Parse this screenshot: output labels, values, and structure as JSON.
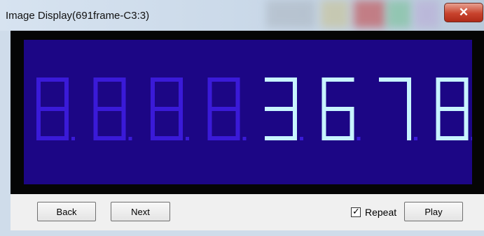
{
  "window": {
    "title": "Image Display(691frame-C3:3)",
    "close_glyph": "✕"
  },
  "display": {
    "background": "#1c0685",
    "lit_color": "#c8f4ff",
    "dim_color": "#3a1ad8",
    "digits": [
      "8",
      "8",
      "8",
      "8",
      "3",
      "6",
      "7",
      "8"
    ],
    "lit": [
      false,
      false,
      false,
      false,
      true,
      true,
      true,
      true
    ]
  },
  "controls": {
    "back_label": "Back",
    "next_label": "Next",
    "repeat_label": "Repeat",
    "repeat_checked": true,
    "play_label": "Play"
  }
}
